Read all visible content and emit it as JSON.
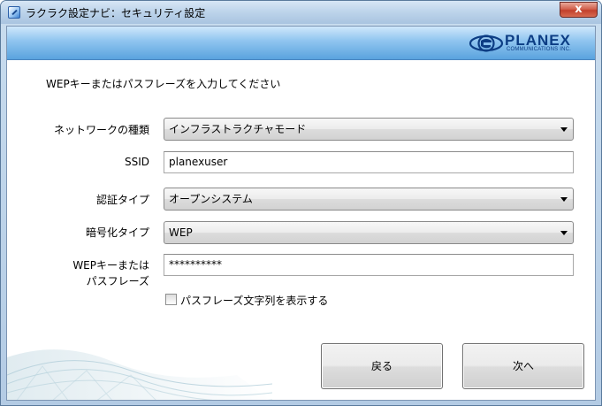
{
  "window": {
    "title": "ラクラク設定ナビ：セキュリティ設定",
    "close_label": "x"
  },
  "brand": {
    "name": "PLANEX",
    "subtitle": "COMMUNICATIONS INC."
  },
  "instruction": "WEPキーまたはパスフレーズを入力してください",
  "form": {
    "network_type": {
      "label": "ネットワークの種類",
      "value": "インフラストラクチャモード"
    },
    "ssid": {
      "label": "SSID",
      "value": "planexuser"
    },
    "auth_type": {
      "label": "認証タイプ",
      "value": "オープンシステム"
    },
    "encryption_type": {
      "label": "暗号化タイプ",
      "value": "WEP"
    },
    "wep_key": {
      "label_line1": "WEPキーまたは",
      "label_line2": "パスフレーズ",
      "value": "**********"
    },
    "show_passphrase": {
      "label": "パスフレーズ文字列を表示する",
      "checked": false
    }
  },
  "buttons": {
    "back": "戻る",
    "next": "次へ"
  },
  "colors": {
    "banner": "#5aa3de",
    "brand": "#0c3d84",
    "close_button": "#c2402c"
  }
}
